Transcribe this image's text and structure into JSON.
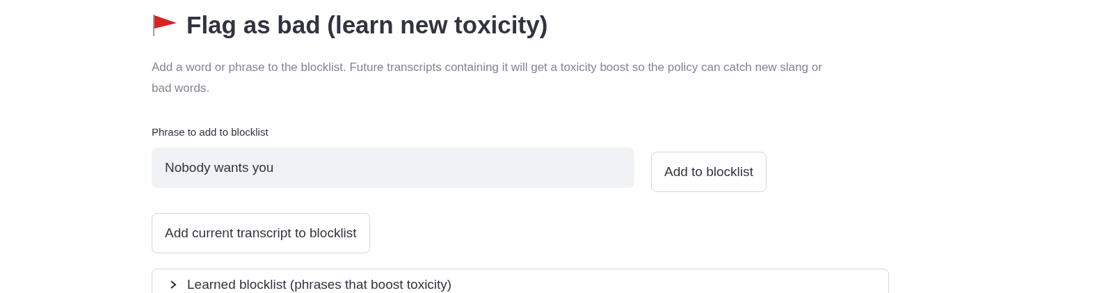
{
  "header": {
    "title": "Flag as bad (learn new toxicity)"
  },
  "description": "Add a word or phrase to the blocklist. Future transcripts containing it will get a toxicity boost so the policy can catch new slang or bad words.",
  "phrase_field": {
    "label": "Phrase to add to blocklist",
    "value": "Nobody wants you"
  },
  "add_button": "Add to blocklist",
  "transcript_button": "Add current transcript to blocklist",
  "expander": {
    "label": "Learned blocklist (phrases that boost toxicity)",
    "expanded": false
  }
}
